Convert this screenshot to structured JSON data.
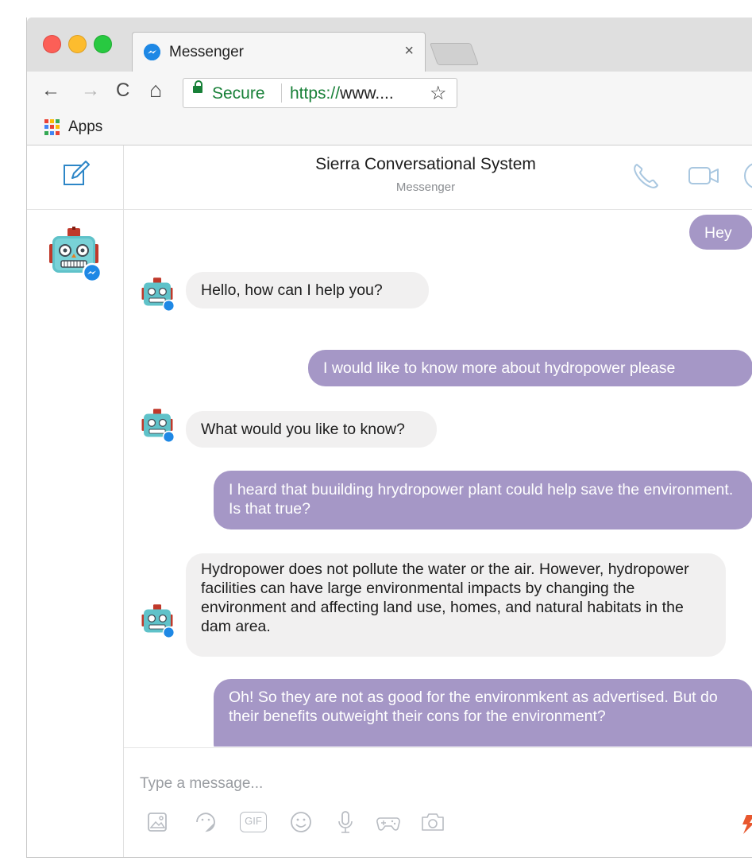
{
  "browser": {
    "tab_title": "Messenger",
    "tab_close": "×",
    "secure_label": "Secure",
    "url_scheme": "https://",
    "url_rest": "www....",
    "bookmark_apps": "Apps",
    "back_glyph": "←",
    "forward_glyph": "→",
    "reload_glyph": "C",
    "home_glyph": "⌂",
    "star_glyph": "☆"
  },
  "header": {
    "name": "Sierra Conversational System",
    "subtitle": "Messenger"
  },
  "messages": [
    {
      "from": "user",
      "text": "Hey"
    },
    {
      "from": "bot",
      "text": "Hello, how can I help you?"
    },
    {
      "from": "user",
      "text": "I would like to know more about hydropower please"
    },
    {
      "from": "bot",
      "text": "What would you like to know?"
    },
    {
      "from": "user",
      "text": "I heard that buuilding hrydropower plant could help save the environment. Is that true?"
    },
    {
      "from": "bot",
      "text": "Hydropower does not pollute the water or the air. However, hydropower facilities can have large environmental impacts by changing the environment and affecting land use, homes, and natural habitats in the dam area."
    },
    {
      "from": "user",
      "text": "Oh! So they are not as good for the environmkent as advertised. But do their benefits outweight their cons for the environment?"
    }
  ],
  "composer": {
    "placeholder": "Type a message...",
    "gif_label": "GIF"
  },
  "colors": {
    "outgoing_bubble": "#a597c6",
    "incoming_bubble": "#f1f0f0",
    "messenger_blue": "#1e88e5",
    "icon_blue": "#2d86c7"
  }
}
